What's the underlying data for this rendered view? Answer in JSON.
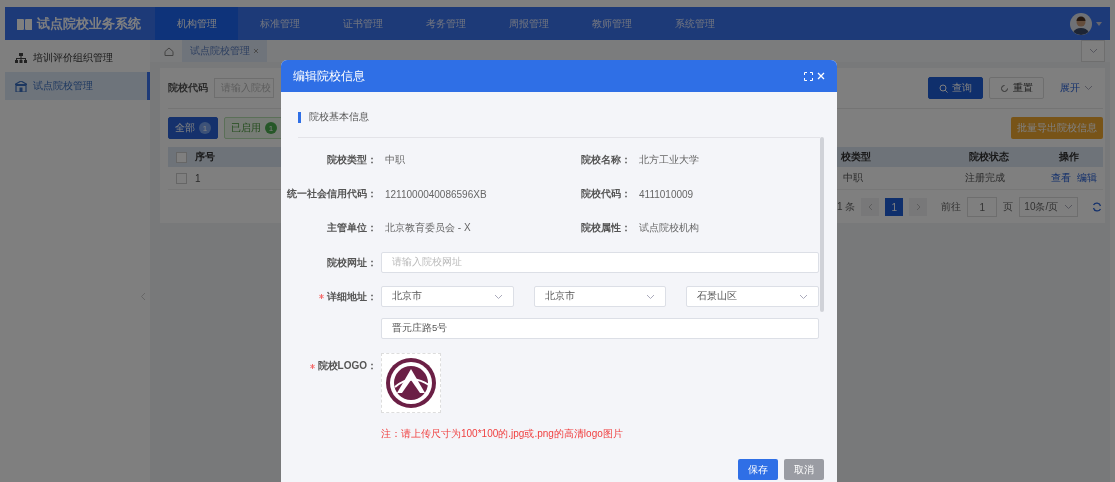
{
  "header": {
    "title": "试点院校业务系统",
    "nav": [
      {
        "label": "机构管理",
        "selected": true
      },
      {
        "label": "标准管理",
        "selected": false
      },
      {
        "label": "证书管理",
        "selected": false
      },
      {
        "label": "考务管理",
        "selected": false
      },
      {
        "label": "周报管理",
        "selected": false
      },
      {
        "label": "教师管理",
        "selected": false
      },
      {
        "label": "系统管理",
        "selected": false
      }
    ]
  },
  "sidebar": {
    "items": [
      {
        "label": "培训评价组织管理",
        "kind": "org",
        "selected": false
      },
      {
        "label": "试点院校管理",
        "kind": "school",
        "selected": true
      }
    ]
  },
  "tabs": [
    {
      "label": "试点院校管理",
      "selected": true
    }
  ],
  "filter": {
    "label": "院校代码",
    "placeholder": "请输入院校",
    "search": "查询",
    "reset": "重置",
    "expand": "展开"
  },
  "status_tags": [
    {
      "label": "全部",
      "count": "1",
      "selected": true
    },
    {
      "label": "已启用",
      "count": "1",
      "selected": false
    }
  ],
  "export_button": "批量导出院校信息",
  "table": {
    "select_all_checked": false,
    "columns": [
      "序号",
      "校类型",
      "院校状态",
      "操作"
    ],
    "rows": [
      {
        "checked": false,
        "index": "1",
        "type": "中职",
        "status": "注册完成",
        "actions": [
          "查看",
          "编辑"
        ]
      }
    ]
  },
  "pagination": {
    "total": "1 条",
    "pages": [
      {
        "label": "1",
        "selected": true
      }
    ],
    "goto_label": "前往",
    "goto_value": "1",
    "page_unit": "页",
    "page_size": "10条/页"
  },
  "modal": {
    "title": "编辑院校信息",
    "section_title": "院校基本信息",
    "info_fields": [
      {
        "label": "院校类型：",
        "value": "中职"
      },
      {
        "label": "院校名称：",
        "value": "北方工业大学"
      },
      {
        "label": "统一社会信用代码：",
        "value": "1211000040086596XB"
      },
      {
        "label": "院校代码：",
        "value": "4111010009"
      },
      {
        "label": "主管单位：",
        "value": "北京教育委员会 - X"
      },
      {
        "label": "院校属性：",
        "value": "试点院校机构"
      }
    ],
    "website": {
      "label": "院校网址：",
      "placeholder": "请输入院校网址",
      "required": false
    },
    "address": {
      "label": "详细地址：",
      "required": true,
      "selects": [
        "北京市",
        "北京市",
        "石景山区"
      ],
      "street": "晋元庄路5号"
    },
    "logo": {
      "label": "院校LOGO：",
      "required": true,
      "note": "注：请上传尺寸为100*100的.jpg或.png的高清logo图片"
    },
    "buttons": [
      {
        "label": "保存",
        "kind": "primary"
      },
      {
        "label": "取消",
        "kind": "secondary"
      }
    ]
  }
}
